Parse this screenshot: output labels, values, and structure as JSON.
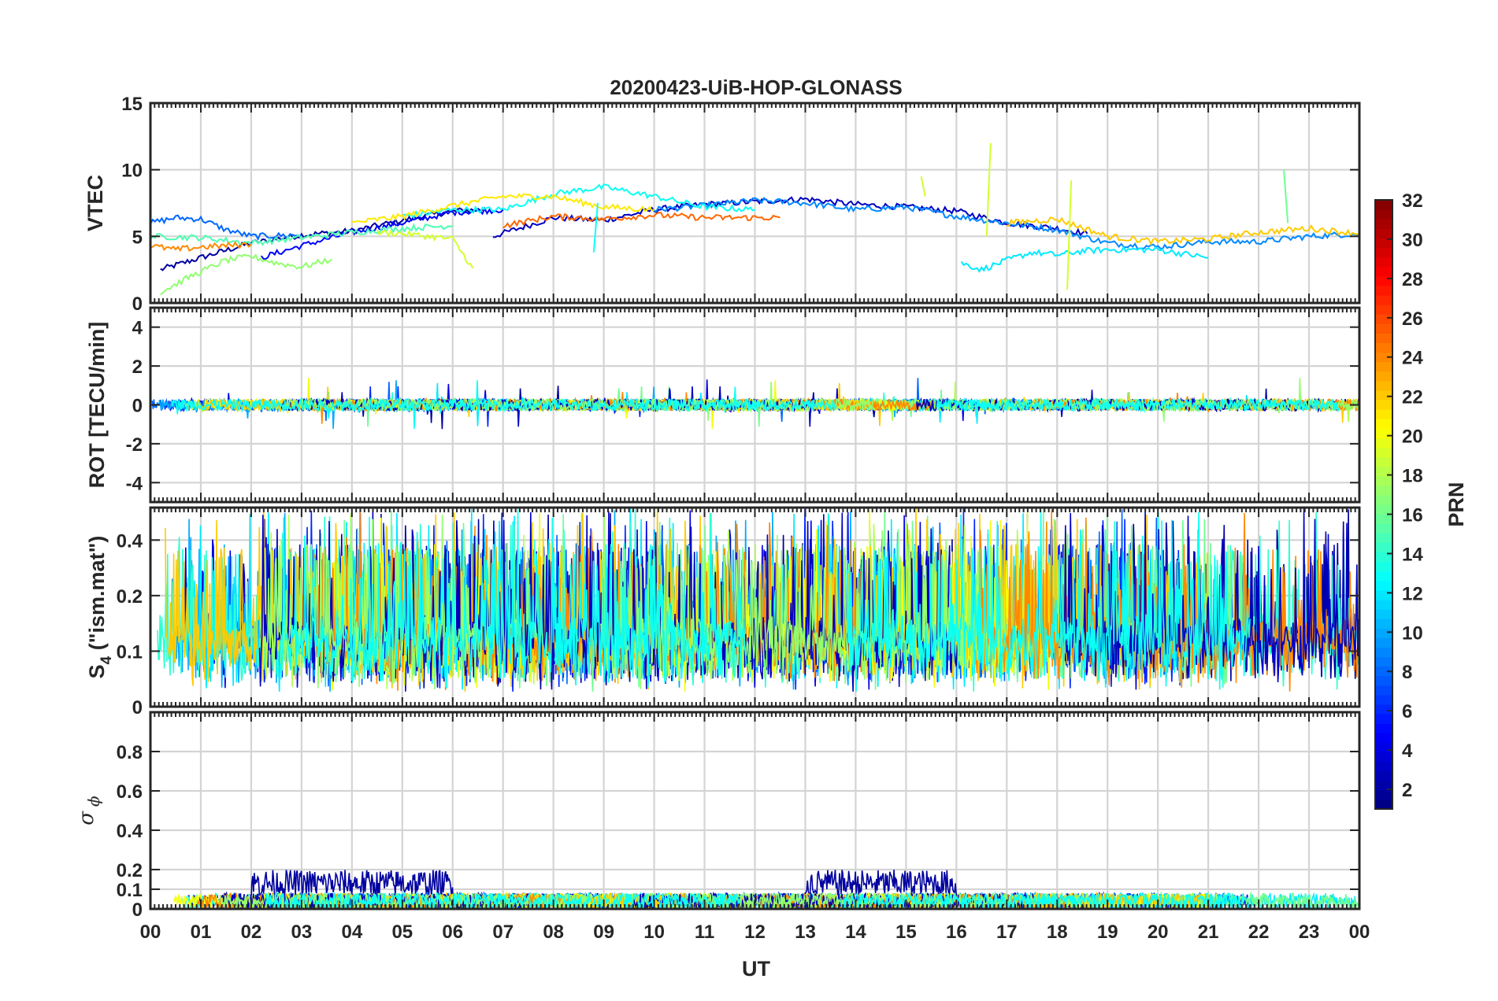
{
  "chart_data": {
    "type": "line",
    "title": "20200423-UiB-HOP-GLONASS",
    "xlabel": "UT",
    "x_tick_labels": [
      "00",
      "01",
      "02",
      "03",
      "04",
      "05",
      "06",
      "07",
      "08",
      "09",
      "10",
      "11",
      "12",
      "13",
      "14",
      "15",
      "16",
      "17",
      "18",
      "19",
      "20",
      "21",
      "22",
      "23",
      "00"
    ],
    "xlim_hours": [
      0,
      24
    ],
    "grid": true,
    "colorbar": {
      "label": "PRN",
      "range": [
        1,
        32
      ],
      "tick_labels": [
        "2",
        "4",
        "6",
        "8",
        "10",
        "12",
        "14",
        "16",
        "18",
        "20",
        "22",
        "24",
        "26",
        "28",
        "30",
        "32"
      ],
      "colormap": "jet",
      "placement": "right"
    },
    "panels": [
      {
        "id": "vtec",
        "ylabel": "VTEC",
        "ylim": [
          0,
          15
        ],
        "y_tick_labels": [
          "0",
          "5",
          "10",
          "15"
        ],
        "series": [
          {
            "prn": 2,
            "x": [
              0.2,
              1,
              2,
              3,
              4,
              5,
              6,
              6.6
            ],
            "y": [
              2.5,
              3.4,
              4.5,
              5.1,
              5.4,
              6.2,
              6.9,
              7.0
            ]
          },
          {
            "prn": 3,
            "x": [
              6.8,
              8,
              9,
              10,
              11,
              12,
              13,
              14,
              15,
              16,
              17,
              18,
              18.6
            ],
            "y": [
              5.0,
              6.4,
              6.2,
              7.0,
              7.4,
              7.6,
              7.8,
              7.4,
              7.2,
              6.9,
              6.0,
              5.6,
              5.2
            ]
          },
          {
            "prn": 5,
            "x": [
              2.2,
              3,
              4,
              5,
              6,
              7
            ],
            "y": [
              3.4,
              4.3,
              5.3,
              6.0,
              6.8,
              7.0
            ]
          },
          {
            "prn": 8,
            "x": [
              0,
              0.5,
              1,
              1.5,
              2,
              3
            ],
            "y": [
              6.0,
              6.4,
              6.3,
              5.5,
              5.0,
              5.1
            ]
          },
          {
            "prn": 9,
            "x": [
              10,
              11,
              12,
              13,
              14,
              15,
              16,
              17,
              18,
              19,
              20,
              21,
              22,
              23,
              24
            ],
            "y": [
              7.0,
              7.3,
              7.7,
              7.5,
              7.0,
              7.2,
              6.5,
              6.0,
              5.5,
              4.5,
              4.2,
              4.6,
              4.6,
              5.0,
              5.2
            ]
          },
          {
            "prn": 12,
            "x": [
              16.1,
              16.5,
              17,
              17.5,
              18,
              18.5,
              19,
              20,
              21
            ],
            "y": [
              3.0,
              2.5,
              3.2,
              3.8,
              3.6,
              3.9,
              4.0,
              4.0,
              3.4
            ]
          },
          {
            "prn": 13,
            "x": [
              5,
              6,
              7,
              8,
              9,
              10,
              11,
              12
            ],
            "y": [
              6.5,
              7.0,
              7.0,
              8.2,
              8.7,
              8.0,
              7.2,
              7.0
            ]
          },
          {
            "prn": 15,
            "x": [
              0,
              1,
              2,
              3,
              4,
              5,
              6
            ],
            "y": [
              5.0,
              4.9,
              4.5,
              4.9,
              5.3,
              5.6,
              5.8
            ]
          },
          {
            "prn": 17,
            "x": [
              0.2,
              0.8,
              1.5,
              2,
              2.5,
              3,
              3.6
            ],
            "y": [
              0.8,
              2.0,
              3.2,
              3.5,
              3.0,
              2.7,
              3.3
            ]
          },
          {
            "prn": 19,
            "x": [
              4.5,
              5,
              5.5,
              6,
              6.4
            ],
            "y": [
              5.3,
              5.2,
              5.0,
              4.8,
              2.6
            ]
          },
          {
            "prn": 21,
            "x": [
              4,
              5,
              6,
              7,
              8,
              9,
              10
            ],
            "y": [
              6.0,
              6.5,
              7.3,
              8.0,
              8.0,
              7.2,
              7.0
            ]
          },
          {
            "prn": 22,
            "x": [
              17,
              18,
              19,
              20,
              21,
              22,
              23,
              24
            ],
            "y": [
              6.0,
              6.3,
              5.0,
              4.6,
              4.8,
              5.3,
              5.6,
              5.2
            ]
          },
          {
            "prn": 24,
            "x": [
              0,
              0.5,
              1,
              2
            ],
            "y": [
              4.3,
              4.0,
              4.2,
              4.4
            ]
          },
          {
            "prn": 25,
            "x": [
              7,
              8,
              9,
              10,
              11,
              12.5
            ],
            "y": [
              5.8,
              6.5,
              6.3,
              6.6,
              6.4,
              6.4
            ]
          }
        ]
      },
      {
        "id": "rot",
        "ylabel": "ROT [TECU/min]",
        "ylim": [
          -5,
          5
        ],
        "y_tick_labels": [
          "-4",
          "-2",
          "0",
          "2",
          "4"
        ],
        "value_range": [
          -1.3,
          1.5
        ],
        "baseline": 0
      },
      {
        "id": "s4",
        "ylabel": "S",
        "ylabel_subscript": "4",
        "ylabel_suffix": " (\"ism.mat\")",
        "ylim": [
          0,
          0.6
        ],
        "scale": "log",
        "y_tick_labels": [
          "0",
          "0.1",
          "0.2",
          "0.4"
        ],
        "value_range": [
          0.05,
          0.6
        ]
      },
      {
        "id": "sigma_phi",
        "ylabel": "σ",
        "ylabel_subscript": "ϕ",
        "ylim": [
          0,
          1
        ],
        "y_tick_labels": [
          "0",
          "0.1",
          "0.2",
          "0.4",
          "0.6",
          "0.8"
        ],
        "value_range": [
          0,
          0.25
        ]
      }
    ]
  }
}
